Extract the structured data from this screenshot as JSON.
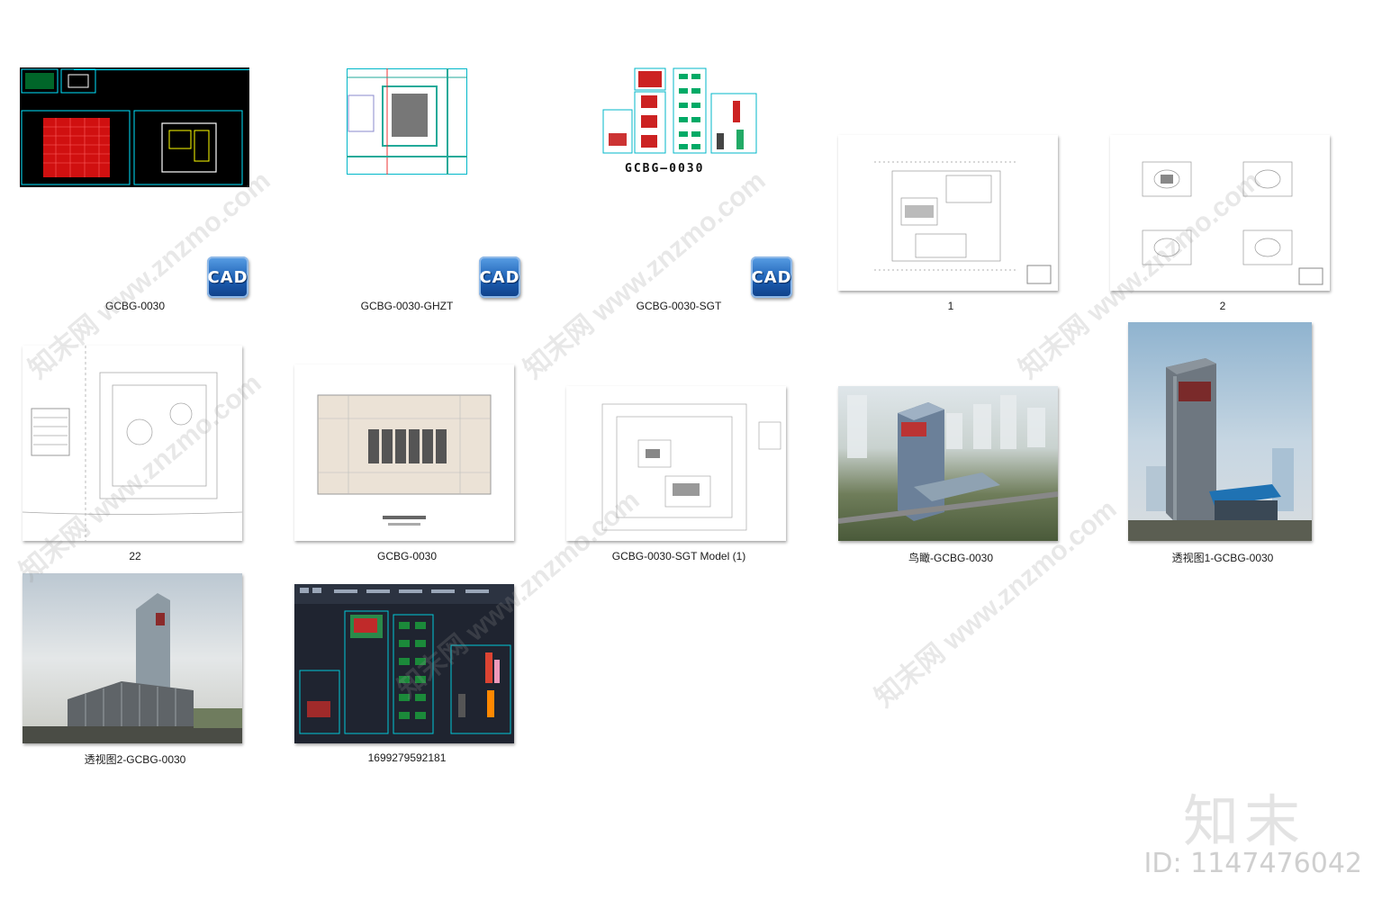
{
  "files": [
    {
      "name": "GCBG-0030",
      "type": "cad"
    },
    {
      "name": "GCBG-0030-GHZT",
      "type": "cad"
    },
    {
      "name": "GCBG-0030-SGT",
      "type": "cad",
      "preview_title": "GCBG—0030"
    },
    {
      "name": "1",
      "type": "image"
    },
    {
      "name": "2",
      "type": "image"
    },
    {
      "name": "22",
      "type": "image"
    },
    {
      "name": "GCBG-0030",
      "type": "image"
    },
    {
      "name": "GCBG-0030-SGT Model (1)",
      "type": "image"
    },
    {
      "name": "鸟瞰-GCBG-0030",
      "type": "image"
    },
    {
      "name": "透视图1-GCBG-0030",
      "type": "image"
    },
    {
      "name": "透视图2-GCBG-0030",
      "type": "image"
    },
    {
      "name": "1699279592181",
      "type": "image"
    }
  ],
  "badge": {
    "text": "CAD",
    "icon": "cad-file-icon"
  },
  "watermark_text": "知末网 www.znzmo.com",
  "brand": {
    "logo": "知末",
    "id_text": "ID: 1147476042"
  },
  "colors": {
    "cad_bg": "#000000",
    "cad_line": "#00e5ff",
    "badge": "#1c5fb4"
  }
}
